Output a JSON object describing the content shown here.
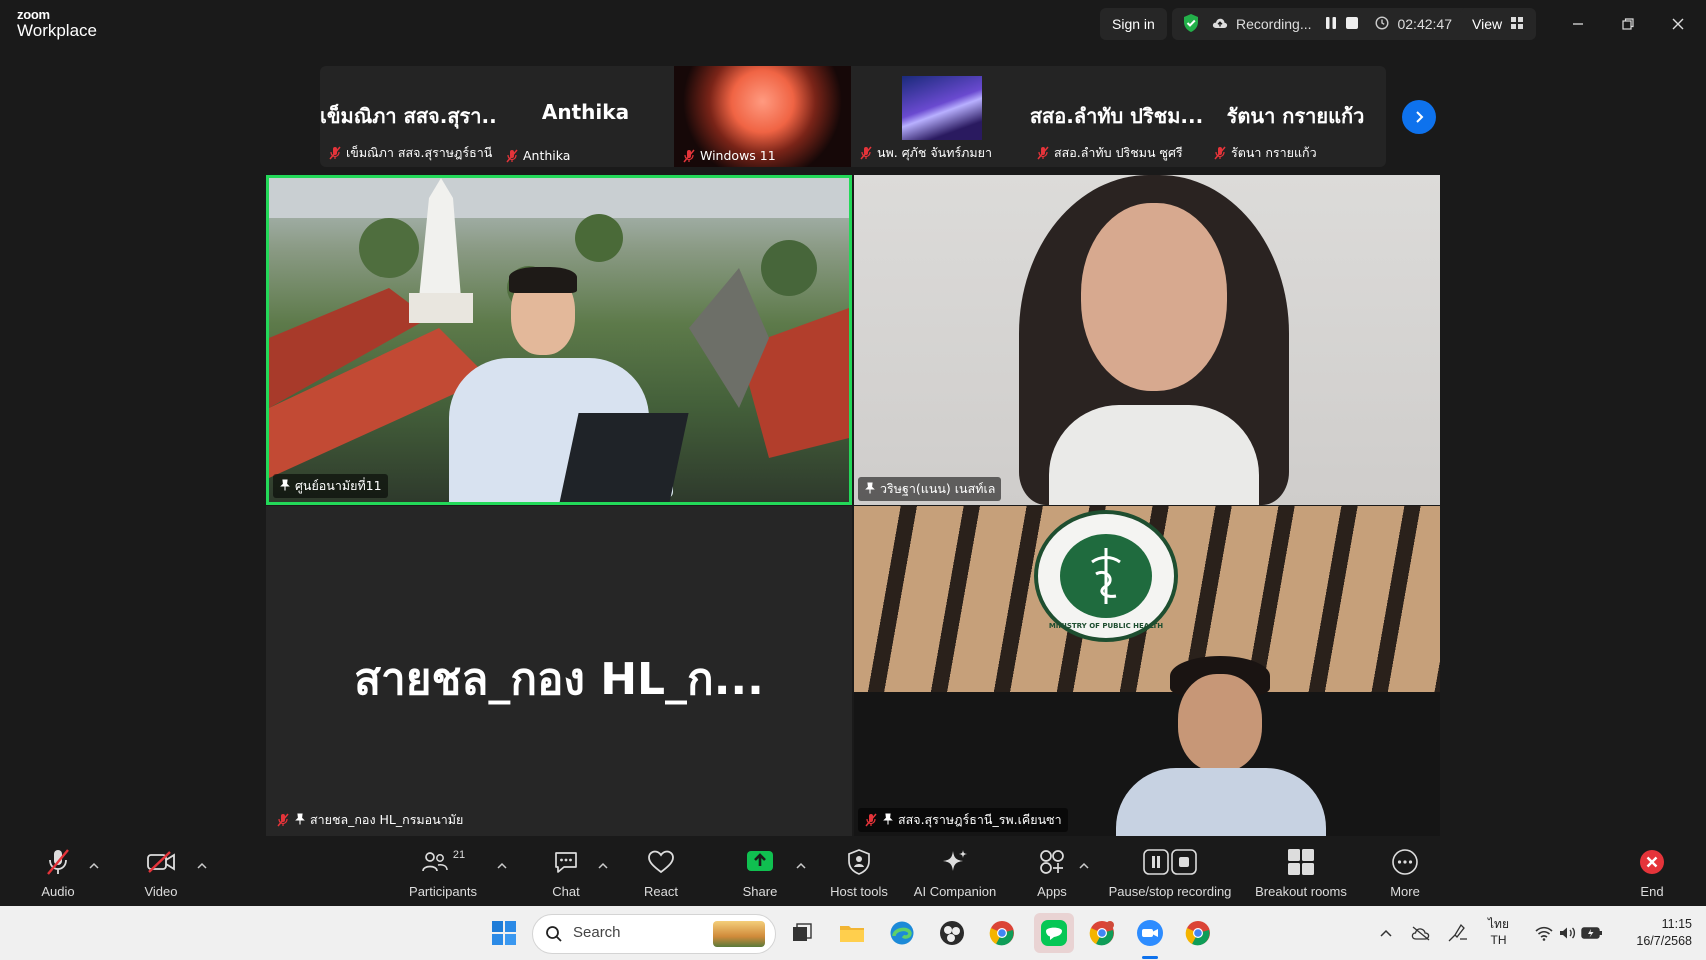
{
  "app": {
    "brand_top": "zoom",
    "brand_bottom": "Workplace"
  },
  "header": {
    "sign_in": "Sign in",
    "recording_label": "Recording...",
    "timer": "02:42:47",
    "view_label": "View"
  },
  "filmstrip": [
    {
      "big": "เข็มณิภา สสจ.สุรา...",
      "caption": "เข็มณิภา สสจ.สุราษฎร์ธานี"
    },
    {
      "big": "Anthika",
      "caption": "Anthika"
    },
    {
      "big": "",
      "caption": "Windows 11"
    },
    {
      "big": "",
      "caption": "นพ. ศุภัช จันทร์ภมยา"
    },
    {
      "big": "สสอ.ลำทับ ปริชม...",
      "caption": "สสอ.ลำทับ ปริชมน ซูศรี"
    },
    {
      "big": "รัตนา กรายแก้ว",
      "caption": "รัตนา กรายแก้ว"
    }
  ],
  "grid": {
    "cell1_name": "ศูนย์อนามัยที่11",
    "cell2_name": "วริษฐา(แนน) เนสท์เล",
    "cell3_big": "สายชล_กอง HL_ก...",
    "cell3_name": "สายชล_กอง HL_กรมอนามัย",
    "cell4_name": "สสจ.สุราษฎร์ธานี_รพ.เคียนซา",
    "seal_text": "MINISTRY OF PUBLIC HEALTH"
  },
  "toolbar": {
    "audio": "Audio",
    "video": "Video",
    "participants": "Participants",
    "participants_count": "21",
    "chat": "Chat",
    "react": "React",
    "share": "Share",
    "host_tools": "Host tools",
    "ai_companion": "AI Companion",
    "apps": "Apps",
    "pause_stop": "Pause/stop recording",
    "breakout": "Breakout rooms",
    "more": "More",
    "end": "End"
  },
  "taskbar": {
    "search_placeholder": "Search",
    "lang_top": "ไทย",
    "lang_bottom": "TH",
    "time": "11:15",
    "date": "16/7/2568"
  },
  "colors": {
    "accent_blue": "#0e72ed",
    "active_speaker": "#23d959",
    "share_green": "#10c050",
    "end_red": "#e5343a",
    "security_green": "#23b04a"
  }
}
